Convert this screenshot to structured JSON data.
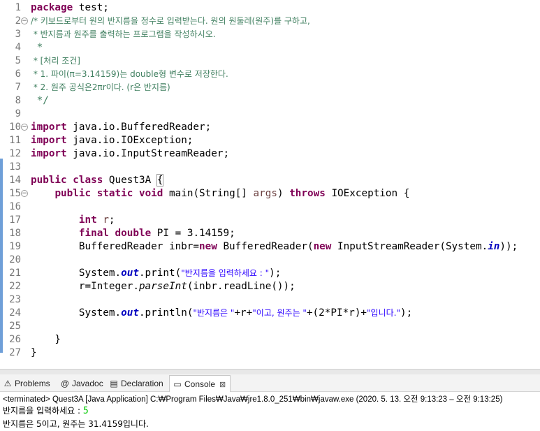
{
  "editor": {
    "lines": [
      {
        "n": "1",
        "fold": "",
        "tokens": [
          {
            "t": "kw",
            "v": "package"
          },
          {
            "t": "plain",
            "v": " test;"
          }
        ]
      },
      {
        "n": "2",
        "fold": "−",
        "tokens": [
          {
            "t": "comment",
            "v": "/* 키보드로부터 원의 반지름을 정수로 입력받는다. 원의 원둘레(원주)를 구하고,"
          }
        ]
      },
      {
        "n": "3",
        "fold": "",
        "tokens": [
          {
            "t": "comment",
            "v": " * 반지름과 원주를 출력하는 프로그램을 작성하시오."
          }
        ]
      },
      {
        "n": "4",
        "fold": "",
        "tokens": [
          {
            "t": "comment",
            "v": " *"
          }
        ]
      },
      {
        "n": "5",
        "fold": "",
        "tokens": [
          {
            "t": "comment",
            "v": " * [처리 조건]"
          }
        ]
      },
      {
        "n": "6",
        "fold": "",
        "tokens": [
          {
            "t": "comment",
            "v": " * 1. 파이(π=3.14159)는 double형 변수로 저장한다."
          }
        ]
      },
      {
        "n": "7",
        "fold": "",
        "tokens": [
          {
            "t": "comment",
            "v": " * 2. 원주 공식은2πr이다. (r은 반지름)"
          }
        ]
      },
      {
        "n": "8",
        "fold": "",
        "tokens": [
          {
            "t": "comment",
            "v": " */"
          }
        ]
      },
      {
        "n": "9",
        "fold": "",
        "tokens": []
      },
      {
        "n": "10",
        "fold": "−",
        "tokens": [
          {
            "t": "kw",
            "v": "import"
          },
          {
            "t": "plain",
            "v": " java.io.BufferedReader;"
          }
        ]
      },
      {
        "n": "11",
        "fold": "",
        "tokens": [
          {
            "t": "kw",
            "v": "import"
          },
          {
            "t": "plain",
            "v": " java.io.IOException;"
          }
        ]
      },
      {
        "n": "12",
        "fold": "",
        "tokens": [
          {
            "t": "kw",
            "v": "import"
          },
          {
            "t": "plain",
            "v": " java.io.InputStreamReader;"
          }
        ]
      },
      {
        "n": "13",
        "fold": "",
        "tokens": []
      },
      {
        "n": "14",
        "fold": "",
        "tokens": [
          {
            "t": "kw",
            "v": "public"
          },
          {
            "t": "plain",
            "v": " "
          },
          {
            "t": "kw",
            "v": "class"
          },
          {
            "t": "plain",
            "v": " Quest3A "
          },
          {
            "t": "bracket",
            "v": "{"
          }
        ]
      },
      {
        "n": "15",
        "fold": "−",
        "tokens": [
          {
            "t": "plain",
            "v": "    "
          },
          {
            "t": "kw",
            "v": "public"
          },
          {
            "t": "plain",
            "v": " "
          },
          {
            "t": "kw",
            "v": "static"
          },
          {
            "t": "plain",
            "v": " "
          },
          {
            "t": "kw",
            "v": "void"
          },
          {
            "t": "plain",
            "v": " main(String[] "
          },
          {
            "t": "param",
            "v": "args"
          },
          {
            "t": "plain",
            "v": ") "
          },
          {
            "t": "kw",
            "v": "throws"
          },
          {
            "t": "plain",
            "v": " IOException {"
          }
        ]
      },
      {
        "n": "16",
        "fold": "",
        "tokens": []
      },
      {
        "n": "17",
        "fold": "",
        "tokens": [
          {
            "t": "plain",
            "v": "        "
          },
          {
            "t": "kw",
            "v": "int"
          },
          {
            "t": "plain",
            "v": " "
          },
          {
            "t": "param",
            "v": "r"
          },
          {
            "t": "plain",
            "v": ";"
          }
        ]
      },
      {
        "n": "18",
        "fold": "",
        "tokens": [
          {
            "t": "plain",
            "v": "        "
          },
          {
            "t": "kw",
            "v": "final"
          },
          {
            "t": "plain",
            "v": " "
          },
          {
            "t": "kw",
            "v": "double"
          },
          {
            "t": "plain",
            "v": " PI = 3.14159;"
          }
        ]
      },
      {
        "n": "19",
        "fold": "",
        "tokens": [
          {
            "t": "plain",
            "v": "        BufferedReader inbr="
          },
          {
            "t": "kw",
            "v": "new"
          },
          {
            "t": "plain",
            "v": " BufferedReader("
          },
          {
            "t": "kw",
            "v": "new"
          },
          {
            "t": "plain",
            "v": " InputStreamReader(System."
          },
          {
            "t": "field",
            "v": "in"
          },
          {
            "t": "plain",
            "v": "));"
          }
        ]
      },
      {
        "n": "20",
        "fold": "",
        "tokens": []
      },
      {
        "n": "21",
        "fold": "",
        "tokens": [
          {
            "t": "plain",
            "v": "        System."
          },
          {
            "t": "field",
            "v": "out"
          },
          {
            "t": "plain",
            "v": ".print("
          },
          {
            "t": "str",
            "v": "\"반지름을 입력하세요 : \""
          },
          {
            "t": "plain",
            "v": ");"
          }
        ]
      },
      {
        "n": "22",
        "fold": "",
        "tokens": [
          {
            "t": "plain",
            "v": "        r=Integer."
          },
          {
            "t": "static",
            "v": "parseInt"
          },
          {
            "t": "plain",
            "v": "(inbr.readLine());"
          }
        ]
      },
      {
        "n": "23",
        "fold": "",
        "tokens": []
      },
      {
        "n": "24",
        "fold": "",
        "tokens": [
          {
            "t": "plain",
            "v": "        System."
          },
          {
            "t": "field",
            "v": "out"
          },
          {
            "t": "plain",
            "v": ".println("
          },
          {
            "t": "str",
            "v": "\"반지름은 \""
          },
          {
            "t": "plain",
            "v": "+r+"
          },
          {
            "t": "str",
            "v": "\"이고, 원주는 \""
          },
          {
            "t": "plain",
            "v": "+(2*PI*r)+"
          },
          {
            "t": "str",
            "v": "\"입니다.\""
          },
          {
            "t": "plain",
            "v": ");"
          }
        ]
      },
      {
        "n": "25",
        "fold": "",
        "tokens": []
      },
      {
        "n": "26",
        "fold": "",
        "tokens": [
          {
            "t": "plain",
            "v": "    }"
          }
        ]
      },
      {
        "n": "27",
        "fold": "",
        "tokens": [
          {
            "t": "plain",
            "v": "}"
          }
        ]
      }
    ],
    "scroll_left_icon": "chevron-left-icon",
    "scroll_left_glyph": "<"
  },
  "tabs": [
    {
      "name": "tab-problems",
      "label": "Problems",
      "icon": "problems-icon",
      "glyph": "⚠",
      "active": false,
      "closable": false
    },
    {
      "name": "tab-javadoc",
      "label": "Javadoc",
      "icon": "javadoc-icon",
      "glyph": "@",
      "active": false,
      "closable": false
    },
    {
      "name": "tab-declaration",
      "label": "Declaration",
      "icon": "declaration-icon",
      "glyph": "▤",
      "active": false,
      "closable": false
    },
    {
      "name": "tab-console",
      "label": "Console",
      "icon": "console-icon",
      "glyph": "▭",
      "active": true,
      "closable": true,
      "close_glyph": "⊠"
    }
  ],
  "console": {
    "header": "<terminated> Quest3A [Java Application] C:₩Program Files₩Java₩jre1.8.0_251₩bin₩javaw.exe  (2020. 5. 13. 오전 9:13:23 – 오전 9:13:25)",
    "prompt": "반지름을 입력하세요 : ",
    "input_value": "5",
    "output": "반지름은 5이고, 원주는 31.4159입니다."
  },
  "colors": {
    "keyword": "#7f0055",
    "comment": "#3f7f5f",
    "string": "#2a00ff",
    "field": "#0000c0",
    "console_input": "#00c800",
    "change_bar": "#6f9fd8"
  }
}
